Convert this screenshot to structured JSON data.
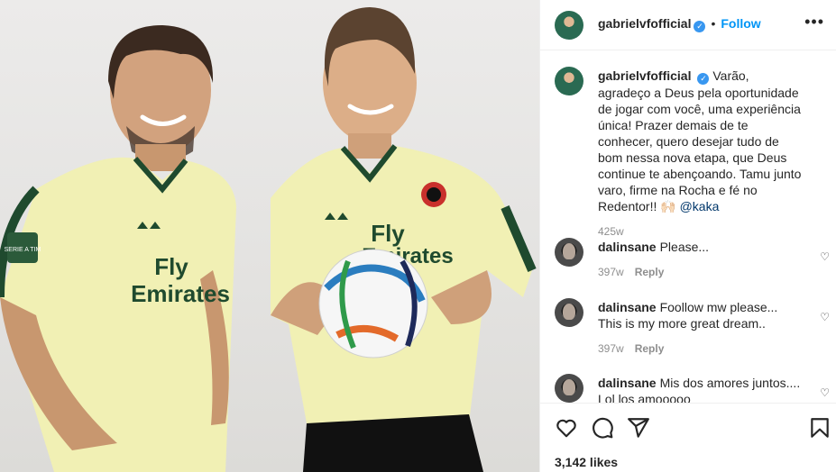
{
  "post": {
    "username": "gabrielvfofficial",
    "follow_label": "Follow",
    "caption": {
      "username": "gabrielvfofficial",
      "text": "Varão, agradeço a Deus pela oportunidade de jogar com você, uma experiência única! Prazer demais de te conhecer, quero desejar tudo de bom nessa nova etapa, que Deus continue te abençoando. Tamu junto varo, firme na Rocha e fé no Redentor!! 🙌🏻 ",
      "mention": "@kaka",
      "time": "425w"
    },
    "comments": [
      {
        "username": "dalinsane",
        "text": "Please...",
        "time": "397w",
        "reply_label": "Reply"
      },
      {
        "username": "dalinsane",
        "text": "Foollow mw please... This is my more great dream..",
        "time": "397w",
        "reply_label": "Reply"
      },
      {
        "username": "dalinsane",
        "text": "Mis dos amores juntos.... Lol los amooooo"
      }
    ],
    "likes": "3,142 likes"
  },
  "image": {
    "jersey_text_left": [
      "Fly",
      "Emirates"
    ],
    "jersey_text_right": [
      "Fly",
      "Emirates"
    ],
    "badge_text": "SERIE A TIM"
  },
  "icons": {
    "verified": "verified-badge-icon",
    "more": "more-options-icon",
    "like": "heart-icon",
    "comment": "comment-icon",
    "share": "share-icon",
    "save": "bookmark-icon"
  },
  "colors": {
    "follow": "#0095f6",
    "verified": "#3897f0",
    "jersey": "#f1f0b4",
    "trim": "#1f4a2e"
  }
}
